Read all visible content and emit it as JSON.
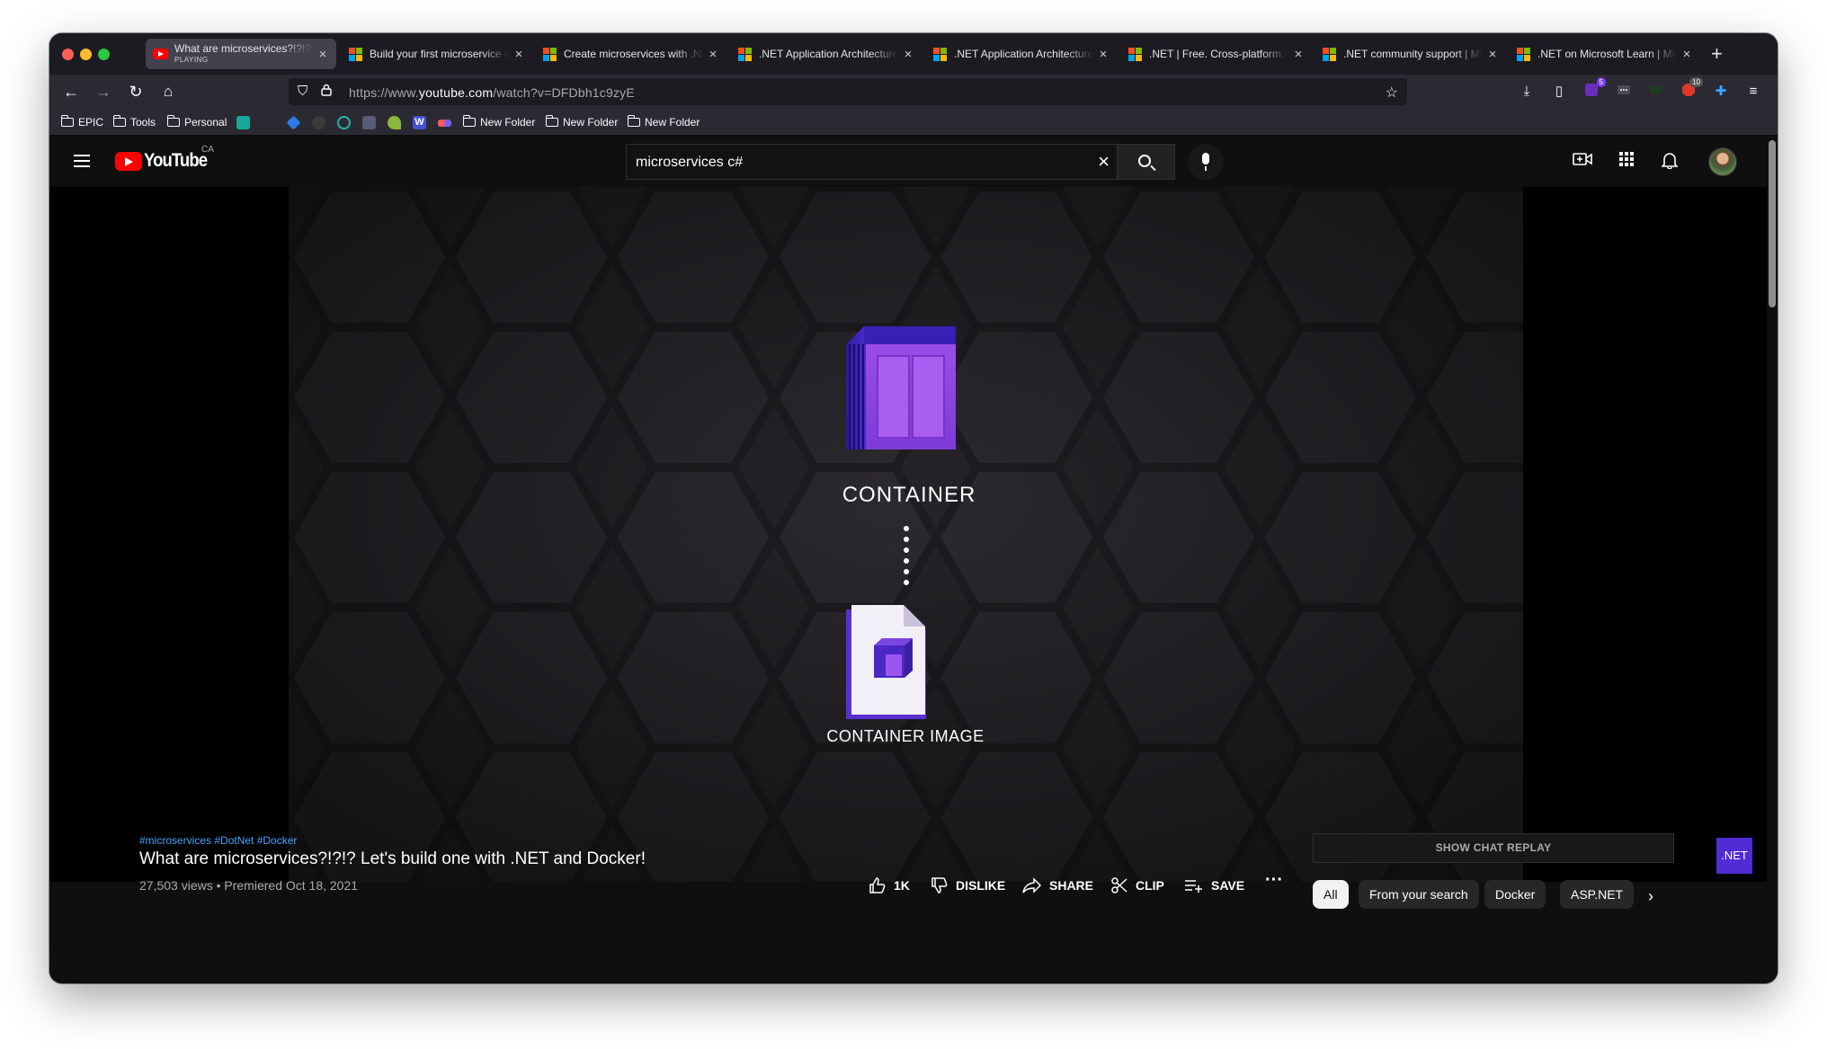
{
  "browser": {
    "tabs": [
      {
        "title": "What are microservices?!?!? Le",
        "subtitle": "PLAYING",
        "favicon": "youtube",
        "active": true
      },
      {
        "title": "Build your first microservice w",
        "favicon": "microsoft"
      },
      {
        "title": "Create microservices with .NE",
        "favicon": "microsoft"
      },
      {
        "title": ".NET Application Architecture",
        "favicon": "microsoft"
      },
      {
        "title": ".NET Application Architecture",
        "favicon": "microsoft"
      },
      {
        "title": ".NET | Free. Cross-platform. O",
        "favicon": "microsoft"
      },
      {
        "title": ".NET community support | Mic",
        "favicon": "microsoft"
      },
      {
        "title": ".NET on Microsoft Learn | Mic",
        "favicon": "microsoft"
      }
    ],
    "url_prefix": "https://www.",
    "url_domain": "youtube.com",
    "url_path": "/watch?v=DFDbh1c9zyE",
    "extension_badges": [
      "5",
      "10"
    ],
    "bookmarks": [
      {
        "label": "EPIC",
        "type": "folder"
      },
      {
        "label": "Tools",
        "type": "folder"
      },
      {
        "label": "Personal",
        "type": "folder"
      },
      {
        "label": "New Folder",
        "type": "folder"
      },
      {
        "label": "New Folder",
        "type": "folder"
      },
      {
        "label": "New Folder",
        "type": "folder"
      }
    ]
  },
  "youtube": {
    "logo_text": "YouTube",
    "country_code": "CA",
    "search_query": "microservices c#"
  },
  "video": {
    "slide_top_label": "CONTAINER",
    "slide_bottom_label": "CONTAINER IMAGE",
    "badge": ".NET",
    "hashtags": "#microservices #DotNet #Docker",
    "title": "What are microservices?!?!? Let's build one with .NET and Docker!",
    "meta": "27,503 views • Premiered Oct 18, 2021",
    "actions": {
      "like": "1K",
      "dislike": "DISLIKE",
      "share": "SHARE",
      "clip": "CLIP",
      "save": "SAVE"
    },
    "show_chat_replay": "SHOW CHAT REPLAY",
    "chips": [
      "All",
      "From your search",
      "Docker",
      "ASP.NET"
    ]
  },
  "colors": {
    "brand_red": "#ff0000",
    "dotnet_purple": "#512bd4",
    "link_blue": "#3ea6ff"
  }
}
